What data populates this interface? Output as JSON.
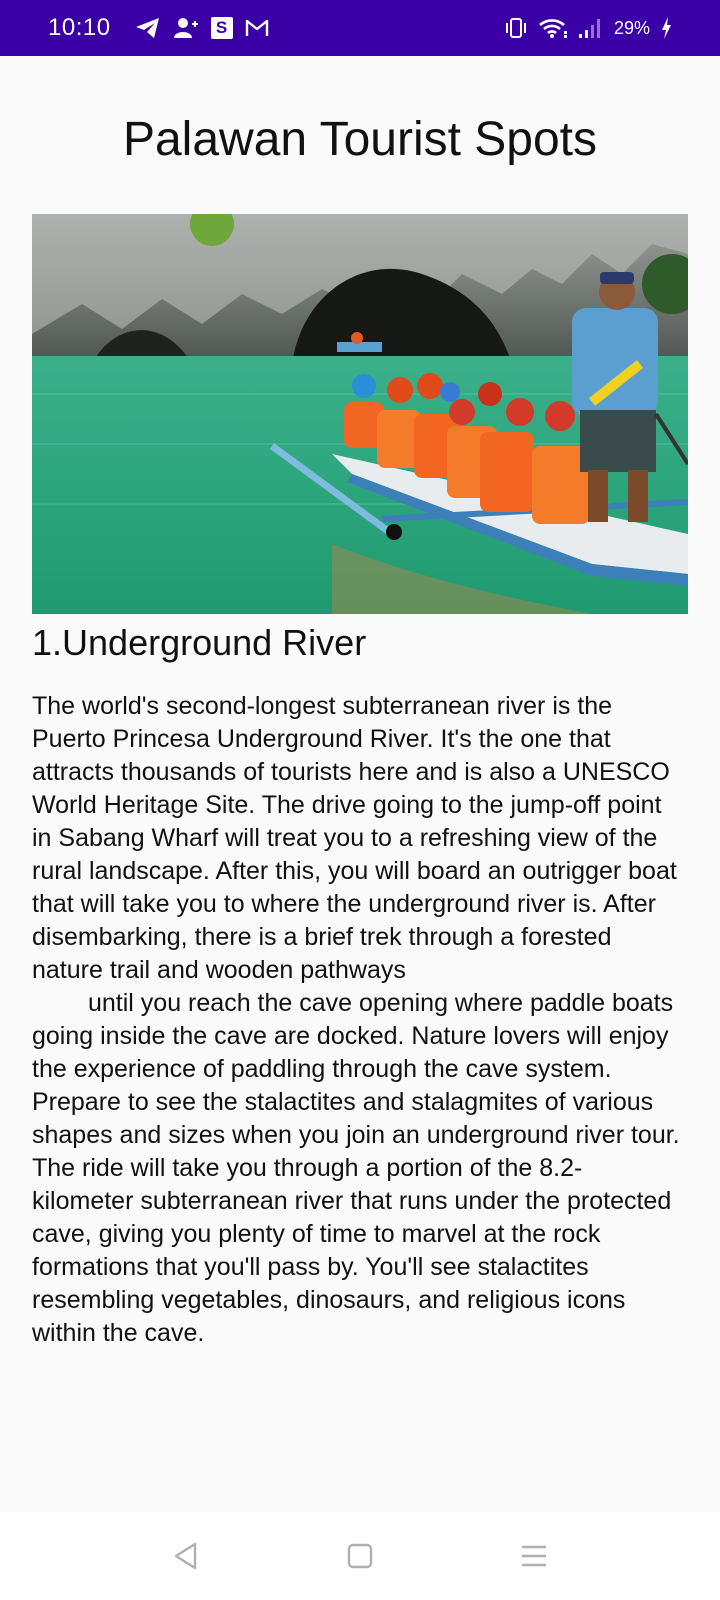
{
  "status_bar": {
    "time": "10:10",
    "battery_percent": "29%",
    "left_icons": [
      "telegram-icon",
      "person-add-icon",
      "s-app-icon",
      "gmail-icon"
    ],
    "right_icons": [
      "vibrate-icon",
      "wifi-icon",
      "signal-icon",
      "battery-icon"
    ],
    "s_icon_letter": "S",
    "colors": {
      "background": "#3a00a6",
      "foreground": "#ffffff"
    }
  },
  "page": {
    "title": "Palawan Tourist Spots",
    "section_heading": "1.Underground River",
    "paragraph_part1": "The world's second-longest subterranean river is the Puerto Princesa Underground River. It's the one that attracts thousands of tourists here and is also a UNESCO World Heritage Site. The drive going to the jump-off point in Sabang Wharf will treat you to a refreshing view of the rural landscape. After this, you will board an outrigger boat that will take you to where the underground river is. After disembarking, there is a brief trek through a forested nature trail and wooden pathways",
    "paragraph_part2": "until you reach the cave opening where paddle boats going inside the cave are docked. Nature lovers will enjoy the experience of paddling through the cave system. Prepare to see the stalactites and stalagmites of various shapes and sizes when you join an underground river tour. The ride will take you through a portion of the 8.2-kilometer subterranean river that runs under the protected cave, giving you plenty of time to marvel at the rock formations that you'll pass by. You'll see stalactites resembling vegetables, dinosaurs, and religious icons within the cave."
  },
  "nav_bar": {
    "buttons": [
      "back-triangle-icon",
      "home-square-icon",
      "menu-lines-icon"
    ]
  }
}
